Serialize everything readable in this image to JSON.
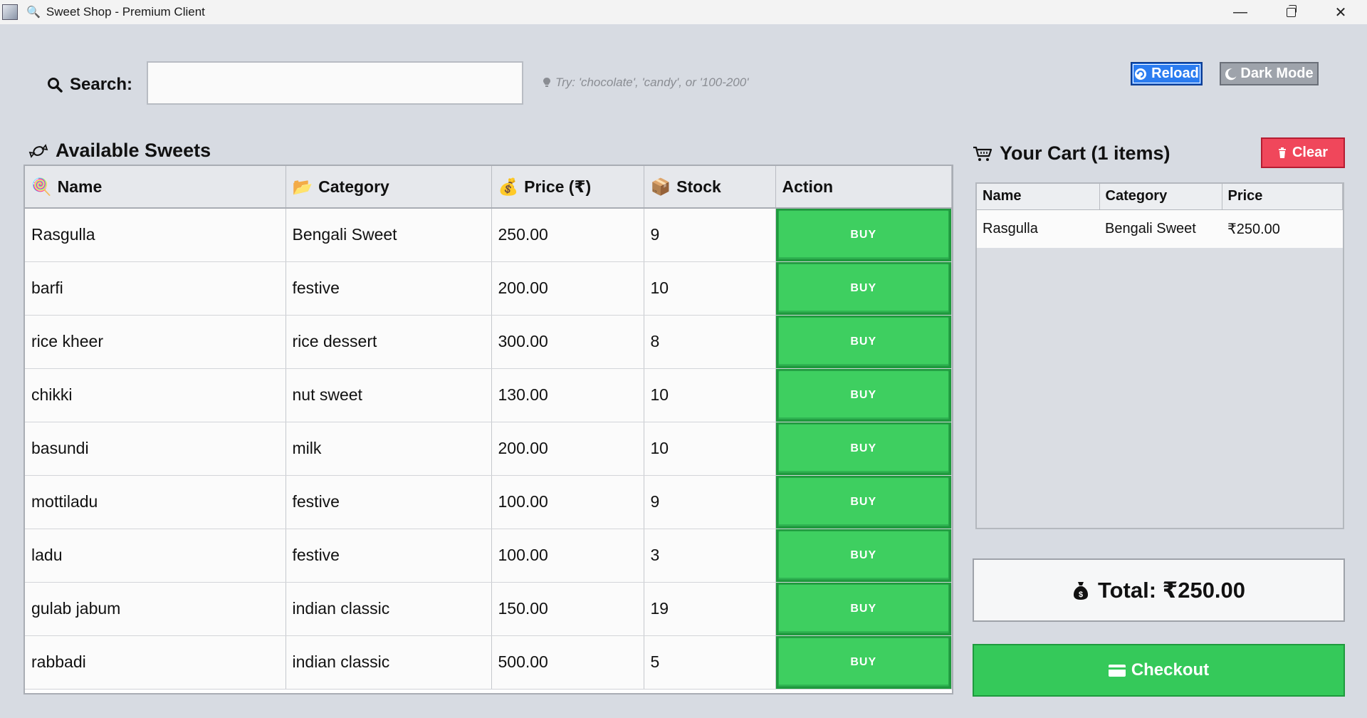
{
  "window": {
    "title_icon": "🔍",
    "title": "Sweet Shop - Premium Client",
    "minimize": "—",
    "close": "✕"
  },
  "search": {
    "label": "Search:",
    "value": "",
    "placeholder": "",
    "hint": "Try: 'chocolate', 'candy', or '100-200'"
  },
  "toolbar": {
    "reload_label": "Reload",
    "dark_mode_label": "Dark Mode"
  },
  "sweets": {
    "title": "Available Sweets",
    "columns": {
      "name": "Name",
      "category": "Category",
      "price": "Price (₹)",
      "stock": "Stock",
      "action": "Action"
    },
    "rows": [
      {
        "name": "Rasgulla",
        "category": "Bengali Sweet",
        "price": "250.00",
        "stock": "9",
        "action": "BUY"
      },
      {
        "name": "barfi",
        "category": "festive",
        "price": "200.00",
        "stock": "10",
        "action": "BUY"
      },
      {
        "name": "rice kheer",
        "category": "rice dessert",
        "price": "300.00",
        "stock": "8",
        "action": "BUY"
      },
      {
        "name": "chikki",
        "category": "nut sweet",
        "price": "130.00",
        "stock": "10",
        "action": "BUY"
      },
      {
        "name": "basundi",
        "category": "milk",
        "price": "200.00",
        "stock": "10",
        "action": "BUY"
      },
      {
        "name": "mottiladu",
        "category": "festive",
        "price": "100.00",
        "stock": "9",
        "action": "BUY"
      },
      {
        "name": "ladu",
        "category": "festive",
        "price": "100.00",
        "stock": "3",
        "action": "BUY"
      },
      {
        "name": "gulab jabum",
        "category": "indian classic",
        "price": "150.00",
        "stock": "19",
        "action": "BUY"
      },
      {
        "name": "rabbadi",
        "category": "indian classic",
        "price": "500.00",
        "stock": "5",
        "action": "BUY"
      }
    ]
  },
  "cart": {
    "title": "Your Cart (1 items)",
    "clear_label": "Clear",
    "columns": {
      "name": "Name",
      "category": "Category",
      "price": "Price"
    },
    "rows": [
      {
        "name": "Rasgulla",
        "category": "Bengali Sweet",
        "price": "₹250.00"
      }
    ],
    "total": "Total: ₹250.00",
    "checkout_label": "Checkout"
  },
  "colors": {
    "buy": "#3ecf60",
    "reload": "#2b7cf0",
    "clear": "#f0475b",
    "checkout": "#35c95a"
  }
}
